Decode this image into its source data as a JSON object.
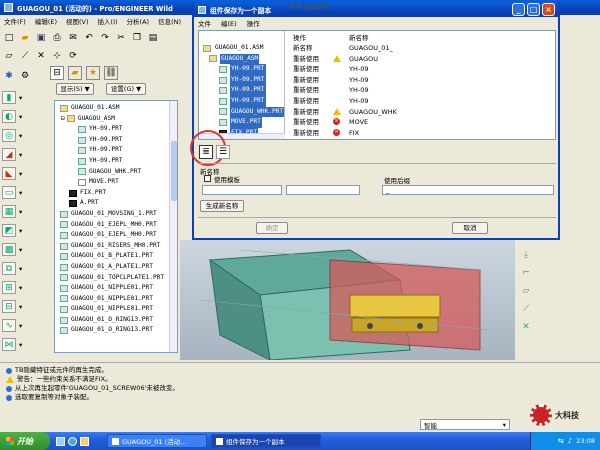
{
  "main_window": {
    "title": "GUAGOU_01 (活动的) - Pro/ENGINEER Wild",
    "menu": [
      "文件(F)",
      "编辑(E)",
      "视图(V)",
      "插入(I)",
      "分析(A)",
      "信息(N)"
    ]
  },
  "model_tree": {
    "show_button": "显示(S) ▼",
    "settings_button": "设置(G) ▼",
    "items": [
      {
        "label": "GUAGOU_01.ASM",
        "icon": "asm",
        "indent": 0
      },
      {
        "label": "GUAGOU_ASM",
        "icon": "asm",
        "indent": 1
      },
      {
        "label": "YH-09.PRT",
        "icon": "part",
        "indent": 2
      },
      {
        "label": "YH-09.PRT",
        "icon": "part",
        "indent": 2
      },
      {
        "label": "YH-09.PRT",
        "icon": "part",
        "indent": 2
      },
      {
        "label": "YH-09.PRT",
        "icon": "part",
        "indent": 2
      },
      {
        "label": "GUAGOU_WHK.PRT",
        "icon": "part",
        "indent": 2
      },
      {
        "label": "MOVE.PRT",
        "icon": "white",
        "indent": 2
      },
      {
        "label": "FIX.PRT",
        "icon": "dark",
        "indent": 1
      },
      {
        "label": "A.PRT",
        "icon": "dark",
        "indent": 1
      },
      {
        "label": "GUAGOU_01_MOVSING_1.PRT",
        "icon": "part",
        "indent": 0
      },
      {
        "label": "GUAGOU_01_EJEPL_MH0.PRT",
        "icon": "part",
        "indent": 0
      },
      {
        "label": "GUAGOU_01_EJEPL_MH0.PRT",
        "icon": "part",
        "indent": 0
      },
      {
        "label": "GUAGOU_01_RISERS_MH0.PRT",
        "icon": "part",
        "indent": 0
      },
      {
        "label": "GUAGOU_01_B_PLATE1.PRT",
        "icon": "part",
        "indent": 0
      },
      {
        "label": "GUAGOU_01_A_PLATE1.PRT",
        "icon": "part",
        "indent": 0
      },
      {
        "label": "GUAGOU_01_TOPCLPLATE1.PRT",
        "icon": "part",
        "indent": 0
      },
      {
        "label": "GUAGOU_01_NIPPLE01.PRT",
        "icon": "part",
        "indent": 0
      },
      {
        "label": "GUAGOU_01_NIPPLE01.PRT",
        "icon": "part",
        "indent": 0
      },
      {
        "label": "GUAGOU_01_NIPPLE01.PRT",
        "icon": "part",
        "indent": 0
      },
      {
        "label": "GUAGOU_01_O_RING13.PRT",
        "icon": "part",
        "indent": 0
      },
      {
        "label": "GUAGOU_01_O_RING13.PRT",
        "icon": "part",
        "indent": 0
      }
    ]
  },
  "messages": [
    {
      "icon": "info",
      "text": "TB隐藏特征或元件的再生完成。"
    },
    {
      "icon": "warn",
      "text": "警告：一些约束关系不满足FIX。"
    },
    {
      "icon": "info",
      "text": "从上次再生起零件'GUAGOU_01_SCREW06'未被改变。"
    },
    {
      "icon": "info",
      "text": "选取要复制等对象子装配。"
    }
  ],
  "smart_filter": "智能",
  "watermark_text": "大科技",
  "dialog": {
    "title": "组件保存为一个副本",
    "overlay_text": "保存  翻译必究",
    "menu": [
      "文件",
      "编(E)",
      "操作"
    ],
    "col_action": "操作",
    "col_newname": "新名称",
    "tree": [
      {
        "label": "GUAGOU_01.ASM",
        "sel": false
      },
      {
        "label": "GUAGOU_ASM",
        "sel": true
      },
      {
        "label": "YH-09.PRT",
        "sel": true
      },
      {
        "label": "YH-09.PRT",
        "sel": true
      },
      {
        "label": "YH-09.PRT",
        "sel": true
      },
      {
        "label": "YH-09.PRT",
        "sel": true
      },
      {
        "label": "GUAGOU_WHK.PRT",
        "sel": true
      },
      {
        "label": "MOVE.PRT",
        "sel": true
      },
      {
        "label": "FIX.PRT",
        "sel": true
      }
    ],
    "rows": [
      {
        "action": "新名称",
        "status": "",
        "name": "GUAGOU_01_"
      },
      {
        "action": "重新使用",
        "status": "warn",
        "name": "GUAGOU"
      },
      {
        "action": "重新使用",
        "status": "",
        "name": "YH-09"
      },
      {
        "action": "重新使用",
        "status": "",
        "name": "YH-09"
      },
      {
        "action": "重新使用",
        "status": "",
        "name": "YH-09"
      },
      {
        "action": "重新使用",
        "status": "",
        "name": "YH-09"
      },
      {
        "action": "重新使用",
        "status": "warn",
        "name": "GUAGOU_WHK"
      },
      {
        "action": "重新使用",
        "status": "err",
        "name": "MOVE"
      },
      {
        "action": "重新使用",
        "status": "err",
        "name": "FIX"
      }
    ],
    "section_title": "新名称",
    "use_template_label": "使用模板",
    "use_suffix_label": "使用后缀",
    "suffix_value": "_",
    "generate_button": "生成新名称",
    "ok_button": "确定",
    "cancel_button": "取消"
  },
  "taskbar": {
    "start_label": "开始",
    "tasks": [
      "GUAGOU_01 (活动...",
      "组件保存为一个副本"
    ],
    "clock": "23:08"
  }
}
